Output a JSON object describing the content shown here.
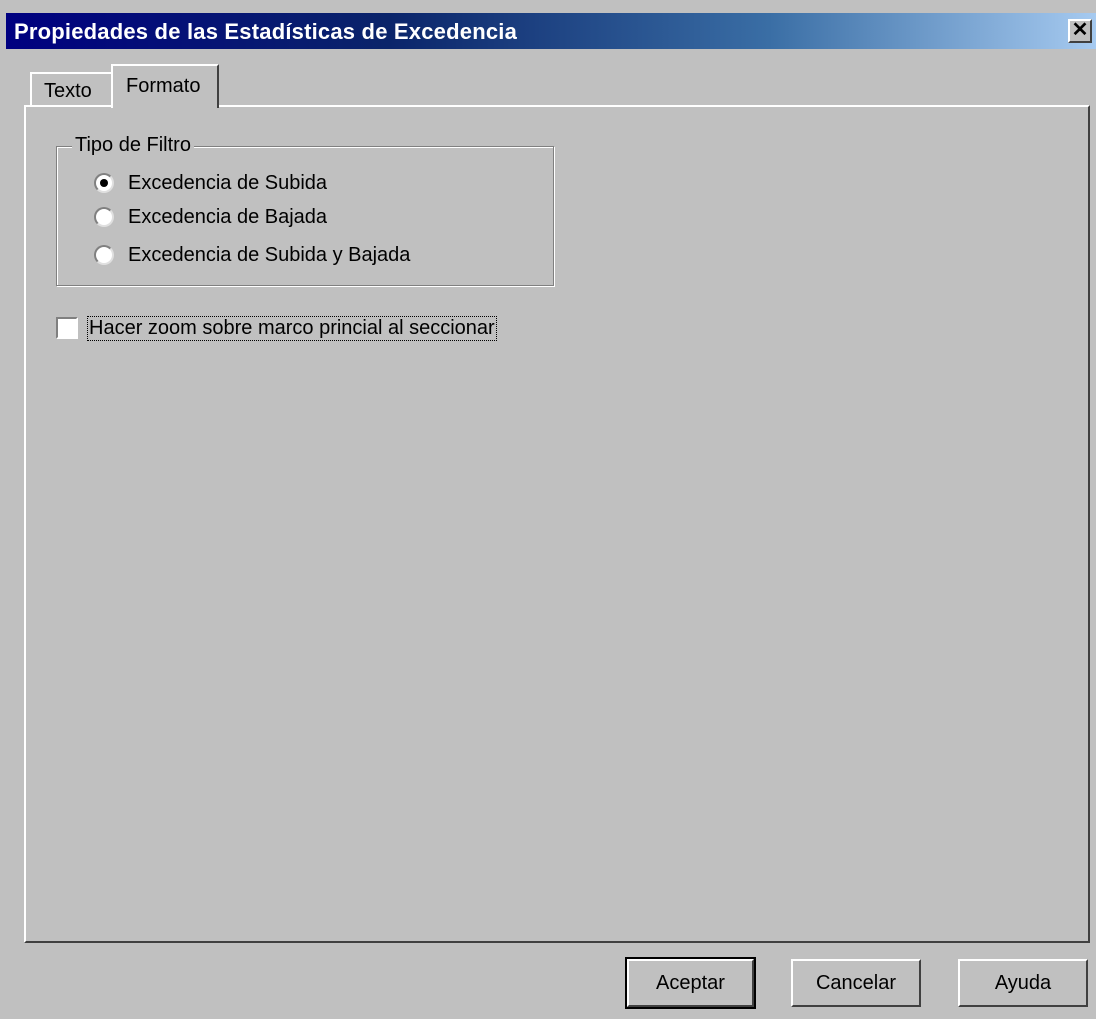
{
  "window": {
    "title": "Propiedades de las Estadísticas de Excedencia",
    "close_glyph": "✕"
  },
  "tabs": [
    {
      "label": "Texto",
      "active": false
    },
    {
      "label": "Formato",
      "active": true
    }
  ],
  "filter_group": {
    "label": "Tipo de Filtro",
    "options": [
      {
        "label": "Excedencia de Subida",
        "selected": true
      },
      {
        "label": "Excedencia de Bajada",
        "selected": false
      },
      {
        "label": "Excedencia de Subida y Bajada",
        "selected": false
      }
    ]
  },
  "zoom_checkbox": {
    "label": "Hacer zoom sobre marco princial al seccionar",
    "checked": false
  },
  "buttons": {
    "ok_label": "Aceptar",
    "cancel_label": "Cancelar",
    "help_label": "Ayuda"
  },
  "colors": {
    "title_bar_start": "#000080",
    "title_bar_end": "#a6caf0",
    "face": "#c0c0c0"
  },
  "icons": {
    "close": "close-icon"
  }
}
